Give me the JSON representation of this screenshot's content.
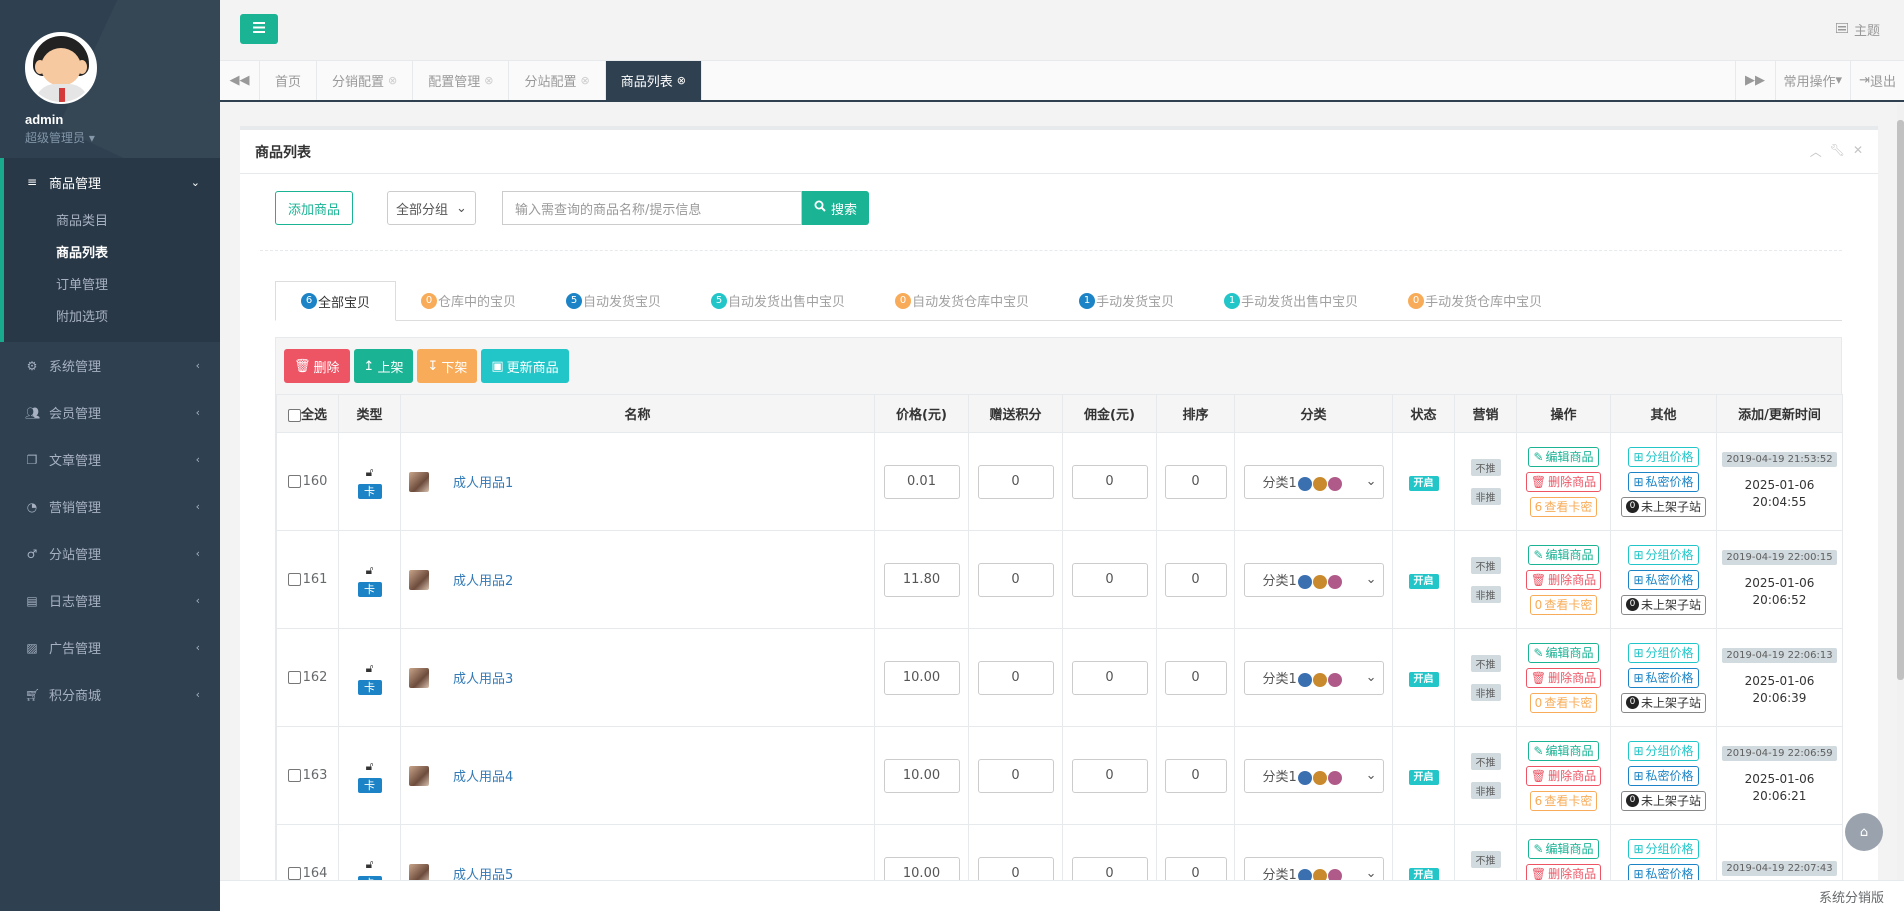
{
  "sidebar": {
    "user": {
      "name": "admin",
      "role": "超级管理员"
    },
    "menu": [
      {
        "label": "商品管理",
        "icon": "list-icon",
        "active": true,
        "children": [
          {
            "label": "商品类目"
          },
          {
            "label": "商品列表",
            "current": true
          },
          {
            "label": "订单管理"
          },
          {
            "label": "附加选项"
          }
        ]
      },
      {
        "label": "系统管理",
        "icon": "gear-icon"
      },
      {
        "label": "会员管理",
        "icon": "users-icon"
      },
      {
        "label": "文章管理",
        "icon": "copy-icon"
      },
      {
        "label": "营销管理",
        "icon": "pie-chart-icon"
      },
      {
        "label": "分站管理",
        "icon": "male-icon"
      },
      {
        "label": "日志管理",
        "icon": "log-icon"
      },
      {
        "label": "广告管理",
        "icon": "picture-icon"
      },
      {
        "label": "积分商城",
        "icon": "cart-icon"
      }
    ]
  },
  "header": {
    "theme_label": "主题"
  },
  "tabs": {
    "items": [
      {
        "label": "首页",
        "closable": false
      },
      {
        "label": "分销配置",
        "closable": true
      },
      {
        "label": "配置管理",
        "closable": true
      },
      {
        "label": "分站配置",
        "closable": true
      },
      {
        "label": "商品列表",
        "closable": true,
        "current": true
      }
    ],
    "common_ops": "常用操作",
    "logout": "退出"
  },
  "box": {
    "title": "商品列表"
  },
  "toolbar": {
    "add_label": "添加商品",
    "group_select": "全部分组",
    "search_placeholder": "输入需查询的商品名称/提示信息",
    "search_label": "搜索"
  },
  "filter_tabs": [
    {
      "count": "6",
      "label": "全部宝贝",
      "color": "#1c84c6"
    },
    {
      "count": "0",
      "label": "仓库中的宝贝",
      "color": "#f8ac59"
    },
    {
      "count": "5",
      "label": "自动发货宝贝",
      "color": "#1c84c6"
    },
    {
      "count": "5",
      "label": "自动发货出售中宝贝",
      "color": "#23c6c8"
    },
    {
      "count": "0",
      "label": "自动发货仓库中宝贝",
      "color": "#f8ac59"
    },
    {
      "count": "1",
      "label": "手动发货宝贝",
      "color": "#1c84c6"
    },
    {
      "count": "1",
      "label": "手动发货出售中宝贝",
      "color": "#23c6c8"
    },
    {
      "count": "0",
      "label": "手动发货仓库中宝贝",
      "color": "#f8ac59"
    }
  ],
  "actions": {
    "delete": "删除",
    "shelve": "上架",
    "unshelve": "下架",
    "update": "更新商品"
  },
  "table": {
    "headers": [
      "全选",
      "类型",
      "名称",
      "价格(元)",
      "赠送积分",
      "佣金(元)",
      "排序",
      "分类",
      "状态",
      "营销",
      "操作",
      "其他",
      "添加/更新时间"
    ],
    "type_badge": "卡",
    "status_label": "开启",
    "marketing": [
      "不推",
      "非推"
    ],
    "ops": {
      "edit": "编辑商品",
      "delete": "删除商品",
      "view_keys": "查看卡密"
    },
    "other": {
      "group_price": "分组价格",
      "private_price": "私密价格",
      "not_listed": "未上架子站"
    },
    "rows": [
      {
        "id": "160",
        "name": "成人用品1",
        "price": "0.01",
        "points": "0",
        "commission": "0",
        "sort": "0",
        "category": "分类1",
        "keys": "6",
        "sub_count": "0",
        "added": "2019-04-19 21:53:52",
        "updated_date": "2025-01-06",
        "updated_time": "20:04:55"
      },
      {
        "id": "161",
        "name": "成人用品2",
        "price": "11.80",
        "points": "0",
        "commission": "0",
        "sort": "0",
        "category": "分类1",
        "keys": "0",
        "sub_count": "0",
        "added": "2019-04-19 22:00:15",
        "updated_date": "2025-01-06",
        "updated_time": "20:06:52"
      },
      {
        "id": "162",
        "name": "成人用品3",
        "price": "10.00",
        "points": "0",
        "commission": "0",
        "sort": "0",
        "category": "分类1",
        "keys": "0",
        "sub_count": "0",
        "added": "2019-04-19 22:06:13",
        "updated_date": "2025-01-06",
        "updated_time": "20:06:39"
      },
      {
        "id": "163",
        "name": "成人用品4",
        "price": "10.00",
        "points": "0",
        "commission": "0",
        "sort": "0",
        "category": "分类1",
        "keys": "6",
        "sub_count": "0",
        "added": "2019-04-19 22:06:59",
        "updated_date": "2025-01-06",
        "updated_time": "20:06:21"
      },
      {
        "id": "164",
        "name": "成人用品5",
        "price": "10.00",
        "points": "0",
        "commission": "0",
        "sort": "0",
        "category": "分类1",
        "keys": "",
        "sub_count": "",
        "added": "2019-04-19 22:07:43",
        "updated_date": "",
        "updated_time": ""
      }
    ]
  },
  "footer": {
    "text": "系统分销版"
  }
}
